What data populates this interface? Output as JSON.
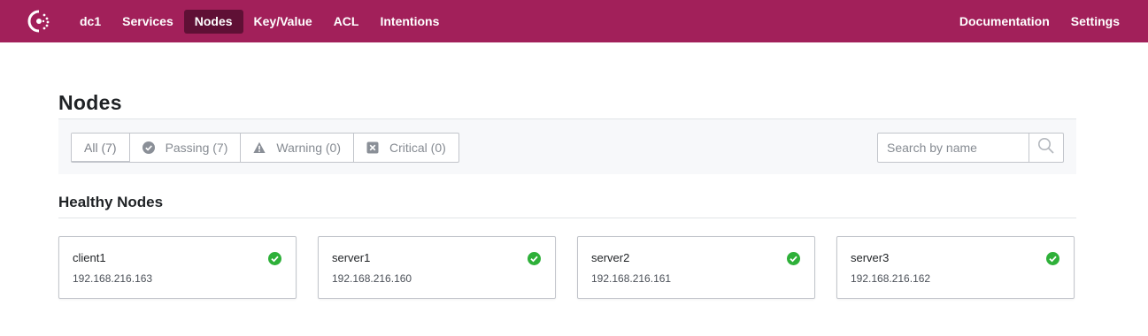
{
  "nav": {
    "datacenter": "dc1",
    "items": [
      {
        "label": "Services"
      },
      {
        "label": "Nodes",
        "active": true
      },
      {
        "label": "Key/Value"
      },
      {
        "label": "ACL"
      },
      {
        "label": "Intentions"
      }
    ],
    "right": [
      {
        "label": "Documentation"
      },
      {
        "label": "Settings"
      }
    ]
  },
  "page": {
    "title": "Nodes"
  },
  "filters": [
    {
      "label": "All (7)",
      "icon": "none",
      "selected": true
    },
    {
      "label": "Passing (7)",
      "icon": "check-circle-icon"
    },
    {
      "label": "Warning (0)",
      "icon": "warning-icon"
    },
    {
      "label": "Critical (0)",
      "icon": "critical-x-icon"
    }
  ],
  "search": {
    "placeholder": "Search by name",
    "value": ""
  },
  "section": {
    "title": "Healthy Nodes"
  },
  "nodes": [
    {
      "name": "client1",
      "address": "192.168.216.163",
      "status": "passing"
    },
    {
      "name": "server1",
      "address": "192.168.216.160",
      "status": "passing"
    },
    {
      "name": "server2",
      "address": "192.168.216.161",
      "status": "passing"
    },
    {
      "name": "server3",
      "address": "192.168.216.162",
      "status": "passing"
    }
  ],
  "colors": {
    "brand": "#a2205a",
    "active_nav": "#5f1035",
    "passing": "#2eb039"
  }
}
